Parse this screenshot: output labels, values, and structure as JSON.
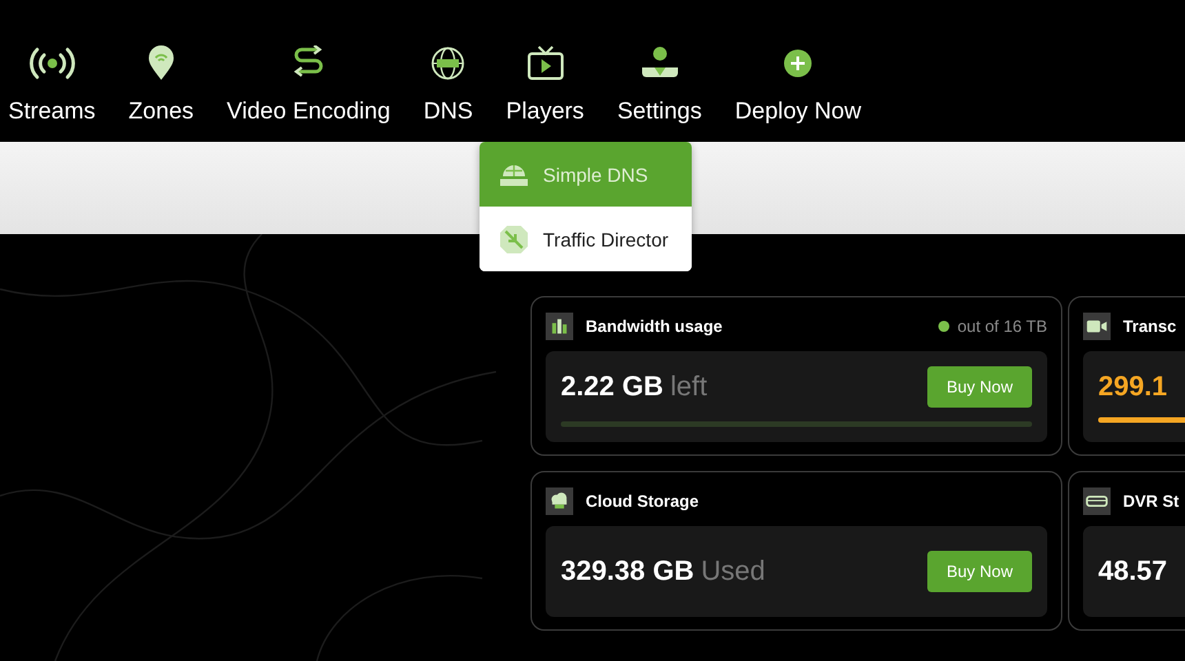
{
  "nav": [
    {
      "label": "Streams"
    },
    {
      "label": "Zones"
    },
    {
      "label": "Video Encoding"
    },
    {
      "label": "DNS"
    },
    {
      "label": "Players"
    },
    {
      "label": "Settings"
    },
    {
      "label": "Deploy Now"
    }
  ],
  "dns_menu": [
    {
      "label": "Simple DNS",
      "selected": true
    },
    {
      "label": "Traffic Director",
      "selected": false
    }
  ],
  "cards": [
    {
      "title": "Bandwidth usage",
      "note": "out of 16 TB",
      "value": "2.22 GB",
      "unit": "left",
      "button": "Buy Now",
      "level": 0
    },
    {
      "title": "Transc",
      "value": "299.1",
      "color": "#f5a623",
      "level": 1
    },
    {
      "title": "Cloud Storage",
      "value": "329.38 GB",
      "unit": "Used",
      "button": "Buy Now"
    },
    {
      "title": "DVR St",
      "value": "48.57"
    }
  ]
}
